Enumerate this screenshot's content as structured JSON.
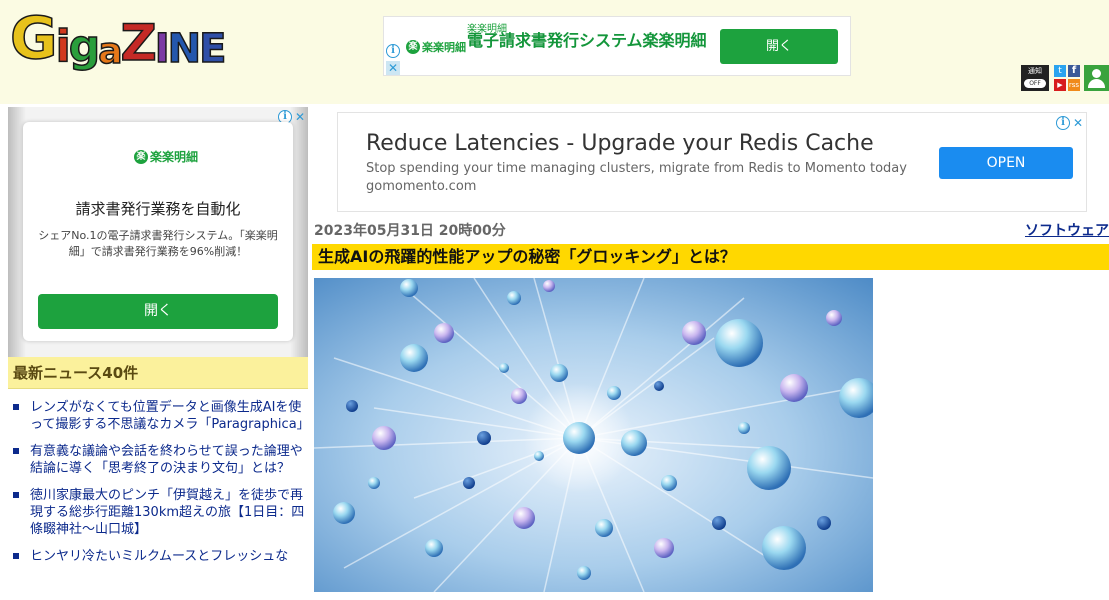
{
  "header": {
    "logo_letters": [
      "G",
      "i",
      "g",
      "a",
      "Z",
      "I",
      "N",
      "E"
    ],
    "top_ad": {
      "brand": "楽楽明細",
      "small": "楽楽明細",
      "title": "電子請求書発行システム楽楽明細",
      "button": "開く"
    },
    "icons": {
      "notify_label": "通知",
      "notify_state": "OFF",
      "twitter": "t",
      "facebook": "f",
      "youtube": "▶",
      "rss": "rss"
    }
  },
  "sidebar": {
    "ad": {
      "brand": "楽楽明細",
      "title": "請求書発行業務を自動化",
      "desc": "シェアNo.1の電子請求書発行システム。「楽楽明細」で請求書発行業務を96%削減！",
      "button": "開く"
    },
    "news_heading": "最新ニュース40件",
    "news": [
      "レンズがなくても位置データと画像生成AIを使って撮影する不思議なカメラ「Paragraphica」",
      "有意義な議論や会話を終わらせて誤った論理や結論に導く「思考終了の決まり文句」とは？",
      "徳川家康最大のピンチ「伊賀越え」を徒歩で再現する総歩行距離130km超えの旅【1日目：四條畷神社〜山口城】",
      "ヒンヤリ冷たいミルクムースとフレッシュな"
    ]
  },
  "main": {
    "ad": {
      "title": "Reduce Latencies - Upgrade your Redis Cache",
      "desc": "Stop spending your time managing clusters, migrate from Redis to Momento today",
      "domain": "gomomento.com",
      "button": "OPEN"
    },
    "date": "2023年05月31日 20時00分",
    "category": "ソフトウェア",
    "headline": "生成AIの飛躍的性能アップの秘密「グロッキング」とは？"
  },
  "ad_controls": {
    "info": "i",
    "close": "✕"
  },
  "colors": {
    "brand_green": "#1da23e",
    "headline_bg": "#ffd800",
    "link": "#0c2a8c",
    "header_bg": "#fbfbe3"
  }
}
